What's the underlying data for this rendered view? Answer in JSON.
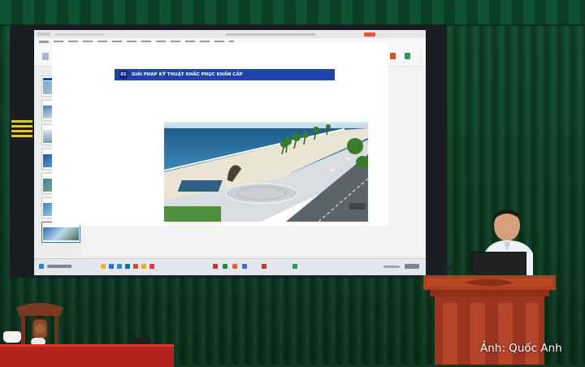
{
  "slide": {
    "number": "01",
    "title": "GIẢI PHÁP KỸ THUẬT KHẮC PHỤC KHẨN CẤP"
  },
  "watermark": "Ảnh: Quốc Anh",
  "colors": {
    "curtain": "#0c3d23",
    "slide_header": "#1e44a8",
    "tablecloth": "#b4221e",
    "podium": "#9c3520"
  }
}
